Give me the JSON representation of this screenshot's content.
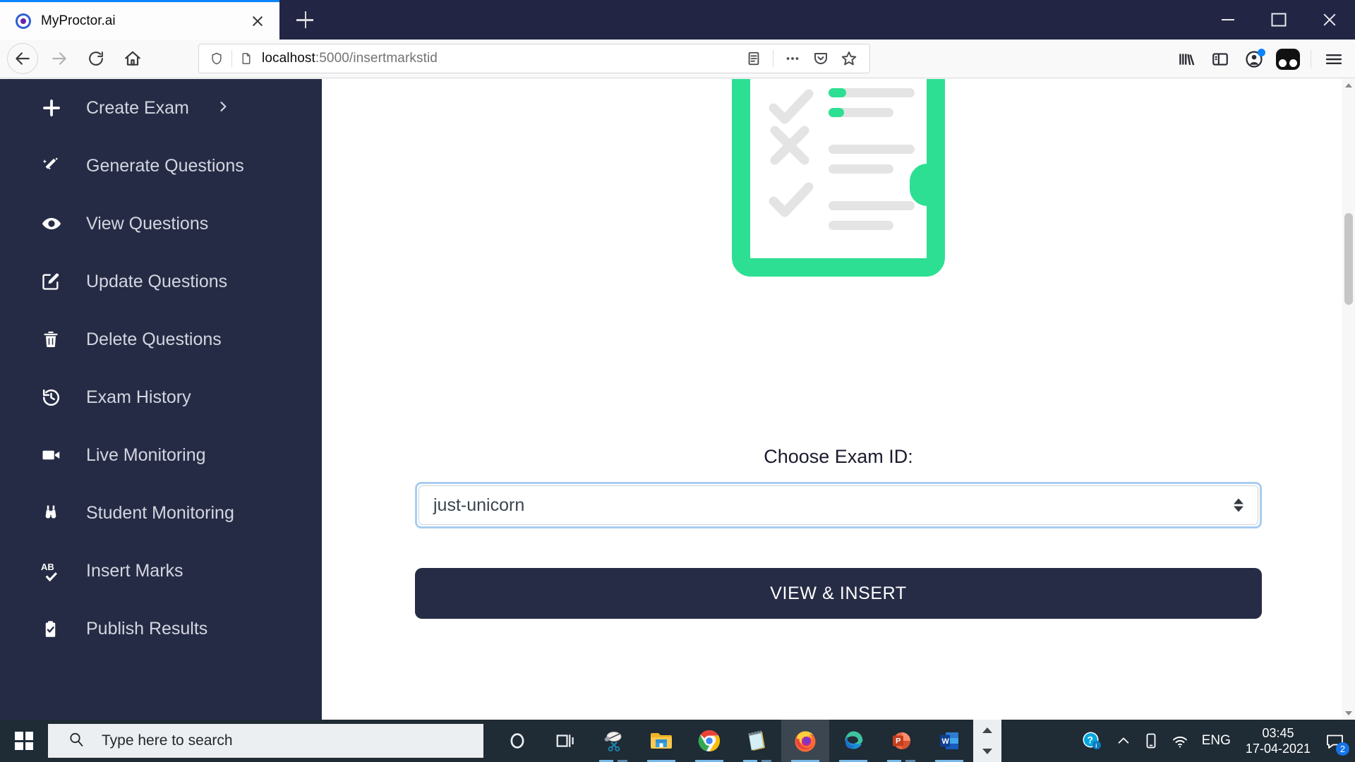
{
  "browser": {
    "tab": {
      "title": "MyProctor.ai",
      "favicon_icon": "myproctor-favicon",
      "close_icon": "close-icon"
    },
    "newtab_icon": "plus-icon",
    "window_controls": {
      "minimize": "minimize-icon",
      "maximize": "maximize-icon",
      "close": "close-icon"
    },
    "nav": {
      "back_icon": "back-arrow-icon",
      "forward_icon": "forward-arrow-icon",
      "reload_icon": "reload-icon",
      "home_icon": "home-icon"
    },
    "url": {
      "shield_icon": "shield-icon",
      "page_icon": "page-icon",
      "host": "localhost",
      "path": ":5000/insertmarkstid",
      "reader_icon": "reader-view-icon",
      "ellipsis_icon": "page-actions-icon",
      "pocket_icon": "pocket-icon",
      "bookmark_icon": "bookmark-star-icon"
    },
    "toolbar": {
      "library_icon": "library-icon",
      "sidebar_icon": "sidebar-icon",
      "account_icon": "account-icon",
      "extension_icon": "extension-icon",
      "menu_icon": "hamburger-menu-icon"
    }
  },
  "sidebar": {
    "items": [
      {
        "label": "Create Exam",
        "icon": "plus-icon",
        "chevron": "chevron-right-icon"
      },
      {
        "label": "Generate Questions",
        "icon": "magic-wand-icon"
      },
      {
        "label": "View Questions",
        "icon": "eye-icon"
      },
      {
        "label": "Update Questions",
        "icon": "edit-square-icon"
      },
      {
        "label": "Delete Questions",
        "icon": "trash-icon"
      },
      {
        "label": "Exam History",
        "icon": "history-clock-icon"
      },
      {
        "label": "Live Monitoring",
        "icon": "video-camera-icon"
      },
      {
        "label": "Student Monitoring",
        "icon": "binoculars-icon"
      },
      {
        "label": "Insert Marks",
        "icon": "spellcheck-ab-icon"
      },
      {
        "label": "Publish Results",
        "icon": "clipboard-check-icon"
      }
    ]
  },
  "main": {
    "illustration_icon": "checklist-document-illustration",
    "form_label": "Choose Exam ID:",
    "select": {
      "value": "just-unicorn",
      "arrows_icon": "select-stepper-icon"
    },
    "submit_label": "VIEW & INSERT"
  },
  "colors": {
    "sidebar_bg": "#262b45",
    "accent_green": "#2ddf93",
    "button_dark": "#272c46",
    "focus_blue": "#a8cdf0",
    "taskbar_bg": "#1f2b35"
  },
  "taskbar": {
    "start_icon": "windows-start-icon",
    "search_placeholder": "Type here to search",
    "search_icon": "search-icon",
    "apps": [
      {
        "name": "cortana-icon",
        "active": false,
        "underline": "none"
      },
      {
        "name": "task-view-icon",
        "active": false,
        "underline": "none"
      },
      {
        "name": "snipping-tool-icon",
        "active": false,
        "underline": "split"
      },
      {
        "name": "file-explorer-icon",
        "active": false,
        "underline": "full"
      },
      {
        "name": "chrome-icon",
        "active": false,
        "underline": "full"
      },
      {
        "name": "sticky-notes-icon",
        "active": false,
        "underline": "split"
      },
      {
        "name": "firefox-icon",
        "active": true,
        "underline": "full"
      },
      {
        "name": "edge-icon",
        "active": false,
        "underline": "full"
      },
      {
        "name": "powerpoint-icon",
        "active": false,
        "underline": "split"
      },
      {
        "name": "word-icon",
        "active": false,
        "underline": "full"
      }
    ],
    "tray": {
      "help_icon": "help-question-icon",
      "chevron_icon": "show-hidden-icons-icon",
      "phone_icon": "phone-link-icon",
      "network_icon": "wifi-icon",
      "language": "ENG",
      "time": "03:45",
      "date": "17-04-2021",
      "notification_icon": "action-center-icon",
      "notification_count": "2"
    }
  }
}
